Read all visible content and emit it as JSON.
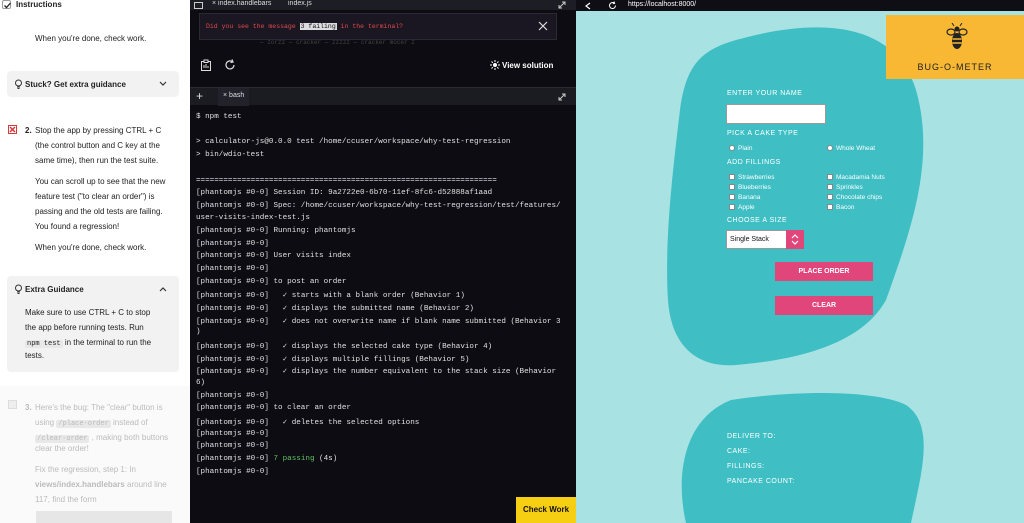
{
  "instructions": {
    "header_title": "Instructions",
    "intro_done": "When you're done, check work.",
    "stuck_label": "Stuck? Get extra guidance",
    "step2_number": "2.",
    "step2_lines": [
      "Stop the app by pressing CTRL + C",
      "(the control button and C key at the",
      "same time), then run the test suite."
    ],
    "scroll_lines": [
      "You can scroll up to see that the new",
      "feature test (\"to clear an order\") is",
      "passing and the old tests are failing.",
      "You found a regression!"
    ],
    "step2_done": "When you're done, check work.",
    "extra_guidance_title": "Extra Guidance",
    "guidance_lines": [
      "Make sure to use CTRL + C to stop",
      "the app before running tests. Run"
    ],
    "guidance_code": "npm test",
    "guidance_tail1": " in the terminal to run the",
    "guidance_tail2": "tests.",
    "step3_number": "3.",
    "step3_line1": "Here's the bug: The \"clear\" button is",
    "step3_using": "using ",
    "step3_code1": "/place-order",
    "step3_insteadof": " instead of",
    "step3_code2": "/clear-order",
    "step3_tail": " , making both buttons",
    "step3_line4": "clear the order!",
    "fix_line1": "Fix the regression, step 1: In",
    "fix_bold": "views/index.handlebars",
    "fix_line2_tail": " around line",
    "fix_line3": "117, find the form"
  },
  "editor": {
    "tabs": [
      "index.handlebars",
      "index.js"
    ],
    "message_prefix": "Did you see the message ",
    "message_highlight": "3 failing",
    "message_suffix": " in the terminal?",
    "ghost_text": "— zorzz — cracker — zzzzz — cracker mocer z",
    "view_solution_label": "View solution",
    "terminal_tab": "bash",
    "terminal_lines": [
      "$ npm test",
      "",
      "> calculator-js@0.0.0 test /home/ccuser/workspace/why-test-regression",
      "> bin/wdio-test",
      "",
      "==================================================================",
      "[phantomjs #0-0] Session ID: 9a2722e0-6b70-11ef-8fc6-d52888af1aad",
      "[phantomjs #0-0] Spec: /home/ccuser/workspace/why-test-regression/test/features/",
      "user-visits-index-test.js",
      "[phantomjs #0-0] Running: phantomjs",
      "[phantomjs #0-0]",
      "[phantomjs #0-0] User visits index",
      "[phantomjs #0-0]",
      "[phantomjs #0-0] to post an order",
      "[phantomjs #0-0]   ✓ starts with a blank order (Behavior 1)",
      "[phantomjs #0-0]   ✓ displays the submitted name (Behavior 2)",
      "[phantomjs #0-0]   ✓ does not overwrite name if blank name submitted (Behavior 3",
      ")",
      "[phantomjs #0-0]   ✓ displays the selected cake type (Behavior 4)",
      "[phantomjs #0-0]   ✓ displays multiple fillings (Behavior 5)",
      "[phantomjs #0-0]   ✓ displays the number equivalent to the stack size (Behavior",
      "6)",
      "[phantomjs #0-0]",
      "[phantomjs #0-0] to clear an order",
      "[phantomjs #0-0]   ✓ deletes the selected options",
      "[phantomjs #0-0]",
      "[phantomjs #0-0]",
      "[phantomjs #0-0] "
    ],
    "passing_text": "7 passing",
    "passing_time": " (4s)",
    "final_prompt": "[phantomjs #0-0]",
    "check_work_label": "Check Work"
  },
  "browser": {
    "url": "https://localhost:8000/",
    "logo_text": "BUG-O-METER",
    "enter_name_label": "ENTER YOUR NAME",
    "cake_type_label": "PICK A CAKE TYPE",
    "cake_types": [
      "Plain",
      "Whole Wheat"
    ],
    "fillings_label": "ADD FILLINGS",
    "fillings_col1": [
      "Strawberries",
      "Blueberries",
      "Banana",
      "Apple"
    ],
    "fillings_col2": [
      "Macadamia Nuts",
      "Sprinkles",
      "Chocolate chips",
      "Bacon"
    ],
    "size_label": "CHOOSE A SIZE",
    "size_selected": "Single Stack",
    "place_order_label": "PLACE ORDER",
    "clear_label": "CLEAR",
    "deliver_to_label": "DELIVER TO:",
    "cake_label": "CAKE:",
    "fillings_out_label": "FILLINGS:",
    "pancake_count_label": "PANCAKE COUNT:",
    "colors": {
      "background": "#a8e2e3",
      "blob": "#3fbfc4",
      "logo_bg": "#f9b833",
      "button": "#e1467a"
    }
  }
}
